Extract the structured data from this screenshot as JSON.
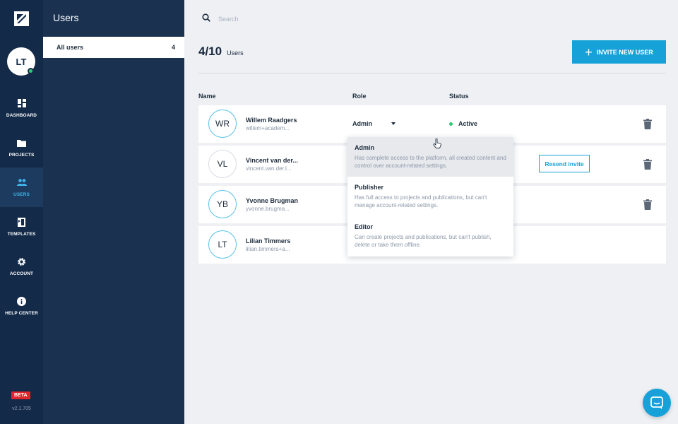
{
  "rail": {
    "avatar_initials": "LT",
    "nav": [
      {
        "label": "DASHBOARD",
        "icon": "dashboard-icon"
      },
      {
        "label": "PROJECTS",
        "icon": "folder-icon"
      },
      {
        "label": "USERS",
        "icon": "users-icon",
        "active": true
      },
      {
        "label": "TEMPLATES",
        "icon": "templates-icon"
      },
      {
        "label": "ACCOUNT",
        "icon": "gear-icon"
      },
      {
        "label": "HELP CENTER",
        "icon": "info-icon"
      }
    ],
    "beta_label": "BETA",
    "version": "v2.1.705"
  },
  "subnav": {
    "title": "Users",
    "items": [
      {
        "label": "All users",
        "count": "4"
      }
    ]
  },
  "search": {
    "placeholder": "Search"
  },
  "summary": {
    "count": "4/10",
    "label": "Users"
  },
  "invite_button": "INVITE NEW USER",
  "table": {
    "headers": {
      "name": "Name",
      "role": "Role",
      "status": "Status"
    },
    "rows": [
      {
        "initials": "WR",
        "name": "Willem Raadgers",
        "email": "willem+academ...",
        "role": "Admin",
        "status": "Active"
      },
      {
        "initials": "VL",
        "name": "Vincent van der...",
        "email": "vincent.van.der.l...",
        "action": "Resend invite"
      },
      {
        "initials": "YB",
        "name": "Yvonne Brugman",
        "email": "yvonne.brugma..."
      },
      {
        "initials": "LT",
        "name": "Lilian Timmers",
        "email": "lilian.timmers+a..."
      }
    ]
  },
  "role_dropdown": {
    "options": [
      {
        "title": "Admin",
        "desc": "Has complete access to the platform, all created content and control over account-related settings."
      },
      {
        "title": "Publisher",
        "desc": "Has full access to projects and publications, but can't manage account-related settings."
      },
      {
        "title": "Editor",
        "desc": "Can create projects and publications, but can't publish, delete or take them offline."
      }
    ]
  },
  "colors": {
    "accent": "#16a2d8",
    "rail": "#132a48",
    "subnav": "#1a3150",
    "active_nav": "#3fb6e8",
    "online": "#2ecc71",
    "beta": "#e3262c"
  }
}
